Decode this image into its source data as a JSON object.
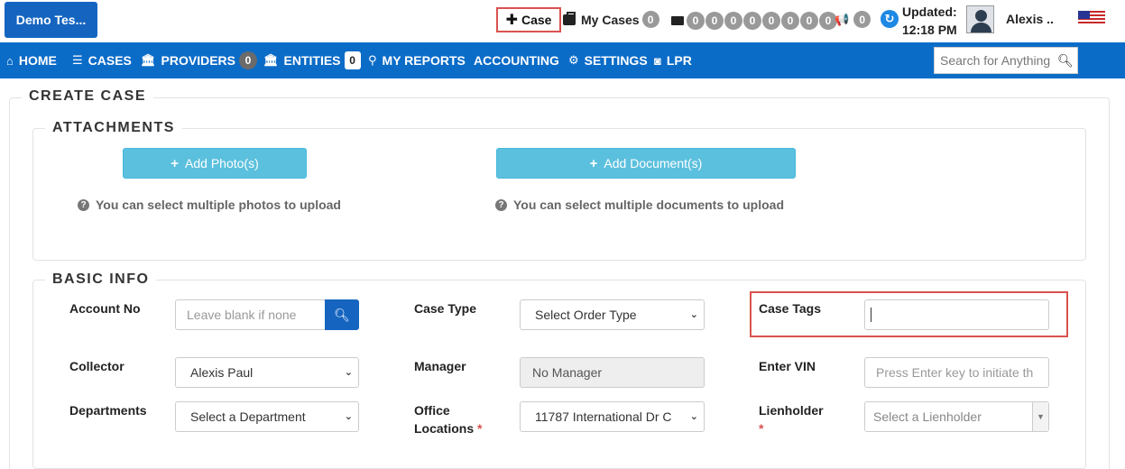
{
  "topbar": {
    "brand": "Demo Tes...",
    "case_button": "Case",
    "my_cases_label": "My Cases",
    "my_cases_count": "0",
    "truck_counts": [
      "0",
      "0",
      "0",
      "0",
      "0",
      "0",
      "0",
      "0"
    ],
    "notifications_count": "0",
    "updated_label": "Updated:",
    "updated_time": "12:18 PM",
    "user_name": "Alexis .."
  },
  "nav": {
    "home": "HOME",
    "cases": "CASES",
    "providers": "PROVIDERS",
    "providers_count": "0",
    "entities": "ENTITIES",
    "entities_count": "0",
    "my_reports": "MY REPORTS",
    "accounting": "ACCOUNTING",
    "settings": "SETTINGS",
    "lpr": "LPR",
    "search_placeholder": "Search for Anything"
  },
  "create_case": {
    "legend": "CREATE CASE",
    "attachments": {
      "legend": "ATTACHMENTS",
      "add_photos": "Add Photo(s)",
      "add_documents": "Add Document(s)",
      "photos_hint": "You can select multiple photos to upload",
      "documents_hint": "You can select multiple documents to upload"
    },
    "basic_info": {
      "legend": "BASIC INFO",
      "account_no_label": "Account No",
      "account_no_placeholder": "Leave blank if none",
      "case_type_label": "Case Type",
      "case_type_value": "Select Order Type",
      "case_tags_label": "Case Tags",
      "case_tags_value": "",
      "collector_label": "Collector",
      "collector_value": "Alexis Paul",
      "manager_label": "Manager",
      "manager_value": "No Manager",
      "enter_vin_label": "Enter VIN",
      "enter_vin_placeholder": "Press Enter key to initiate th",
      "departments_label": "Departments",
      "departments_value": "Select a Department",
      "office_locations_label_1": "Office",
      "office_locations_label_2": "Locations",
      "office_locations_value": "11787 International Dr C",
      "lienholder_label": "Lienholder",
      "lienholder_value": "Select a Lienholder",
      "required_mark": "*"
    }
  },
  "colors": {
    "nav_bg": "#0b6cc8",
    "brand_bg": "#1565c0",
    "info_button": "#5bc0de",
    "highlight": "#d9534f"
  }
}
